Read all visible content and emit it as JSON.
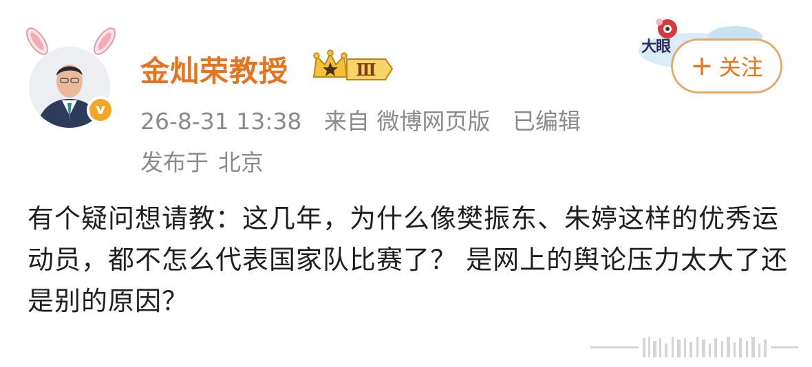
{
  "user": {
    "name": "金灿荣教授",
    "level_badge": "Ⅲ",
    "verified_mark": "v"
  },
  "meta": {
    "timestamp": "26-8-31 13:38",
    "source": "来自 微博网页版",
    "edited": "已编辑"
  },
  "location": {
    "prefix": "发布于",
    "city": "北京"
  },
  "decor_text": "大眼",
  "follow": {
    "plus": "+",
    "label": "关注"
  },
  "post": {
    "text": "有个疑问想请教：这几年，为什么像樊振东、朱婷这样的优秀运动员，都不怎么代表国家队比赛了？ 是网上的舆论压力太大了还是别的原因？"
  },
  "colors": {
    "accent": "#e7731f",
    "meta_gray": "#8a8a8a",
    "badge_gold": "#f6a623",
    "follow_border": "#e8a866"
  }
}
